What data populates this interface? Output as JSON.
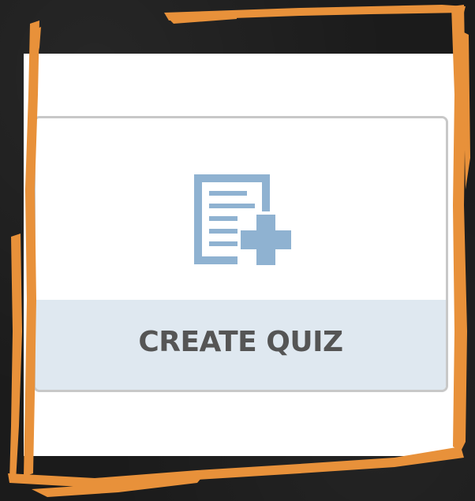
{
  "card": {
    "label": "CREATE QUIZ",
    "icon": "create-quiz-document-plus-icon"
  },
  "colors": {
    "frame": "#e8913a",
    "background": "#1b1b1b",
    "panel": "#ffffff",
    "card_border": "#c8c8c8",
    "card_footer": "#dfe8f0",
    "icon": "#8fb2d1",
    "label": "#555555"
  }
}
